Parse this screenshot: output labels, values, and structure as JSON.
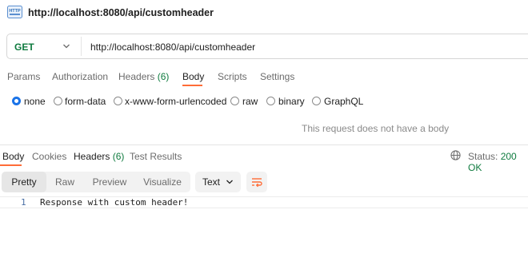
{
  "header": {
    "title": "http://localhost:8080/api/customheader",
    "icon": "http-request-icon"
  },
  "request": {
    "method": "GET",
    "url": "http://localhost:8080/api/customheader",
    "tabs": [
      {
        "label": "Params"
      },
      {
        "label": "Authorization"
      },
      {
        "label": "Headers",
        "count": "(6)"
      },
      {
        "label": "Body",
        "active": true
      },
      {
        "label": "Scripts"
      },
      {
        "label": "Settings"
      }
    ],
    "body_types": [
      "none",
      "form-data",
      "x-www-form-urlencoded",
      "raw",
      "binary",
      "GraphQL"
    ],
    "selected_body_type": "none",
    "no_body_message": "This request does not have a body"
  },
  "response": {
    "tabs": [
      {
        "label": "Body",
        "active": true
      },
      {
        "label": "Cookies"
      },
      {
        "label": "Headers",
        "count": "(6)"
      },
      {
        "label": "Test Results"
      }
    ],
    "status_label": "Status:",
    "status_value": "200 OK",
    "view_modes": [
      "Pretty",
      "Raw",
      "Preview",
      "Visualize"
    ],
    "active_view_mode": "Pretty",
    "format": "Text",
    "lines": [
      {
        "number": "1",
        "text": "Response with custom header!"
      }
    ]
  },
  "colors": {
    "accent": "#ff6c37",
    "success": "#0f7b3f",
    "radio_selected": "#1a73e8"
  }
}
